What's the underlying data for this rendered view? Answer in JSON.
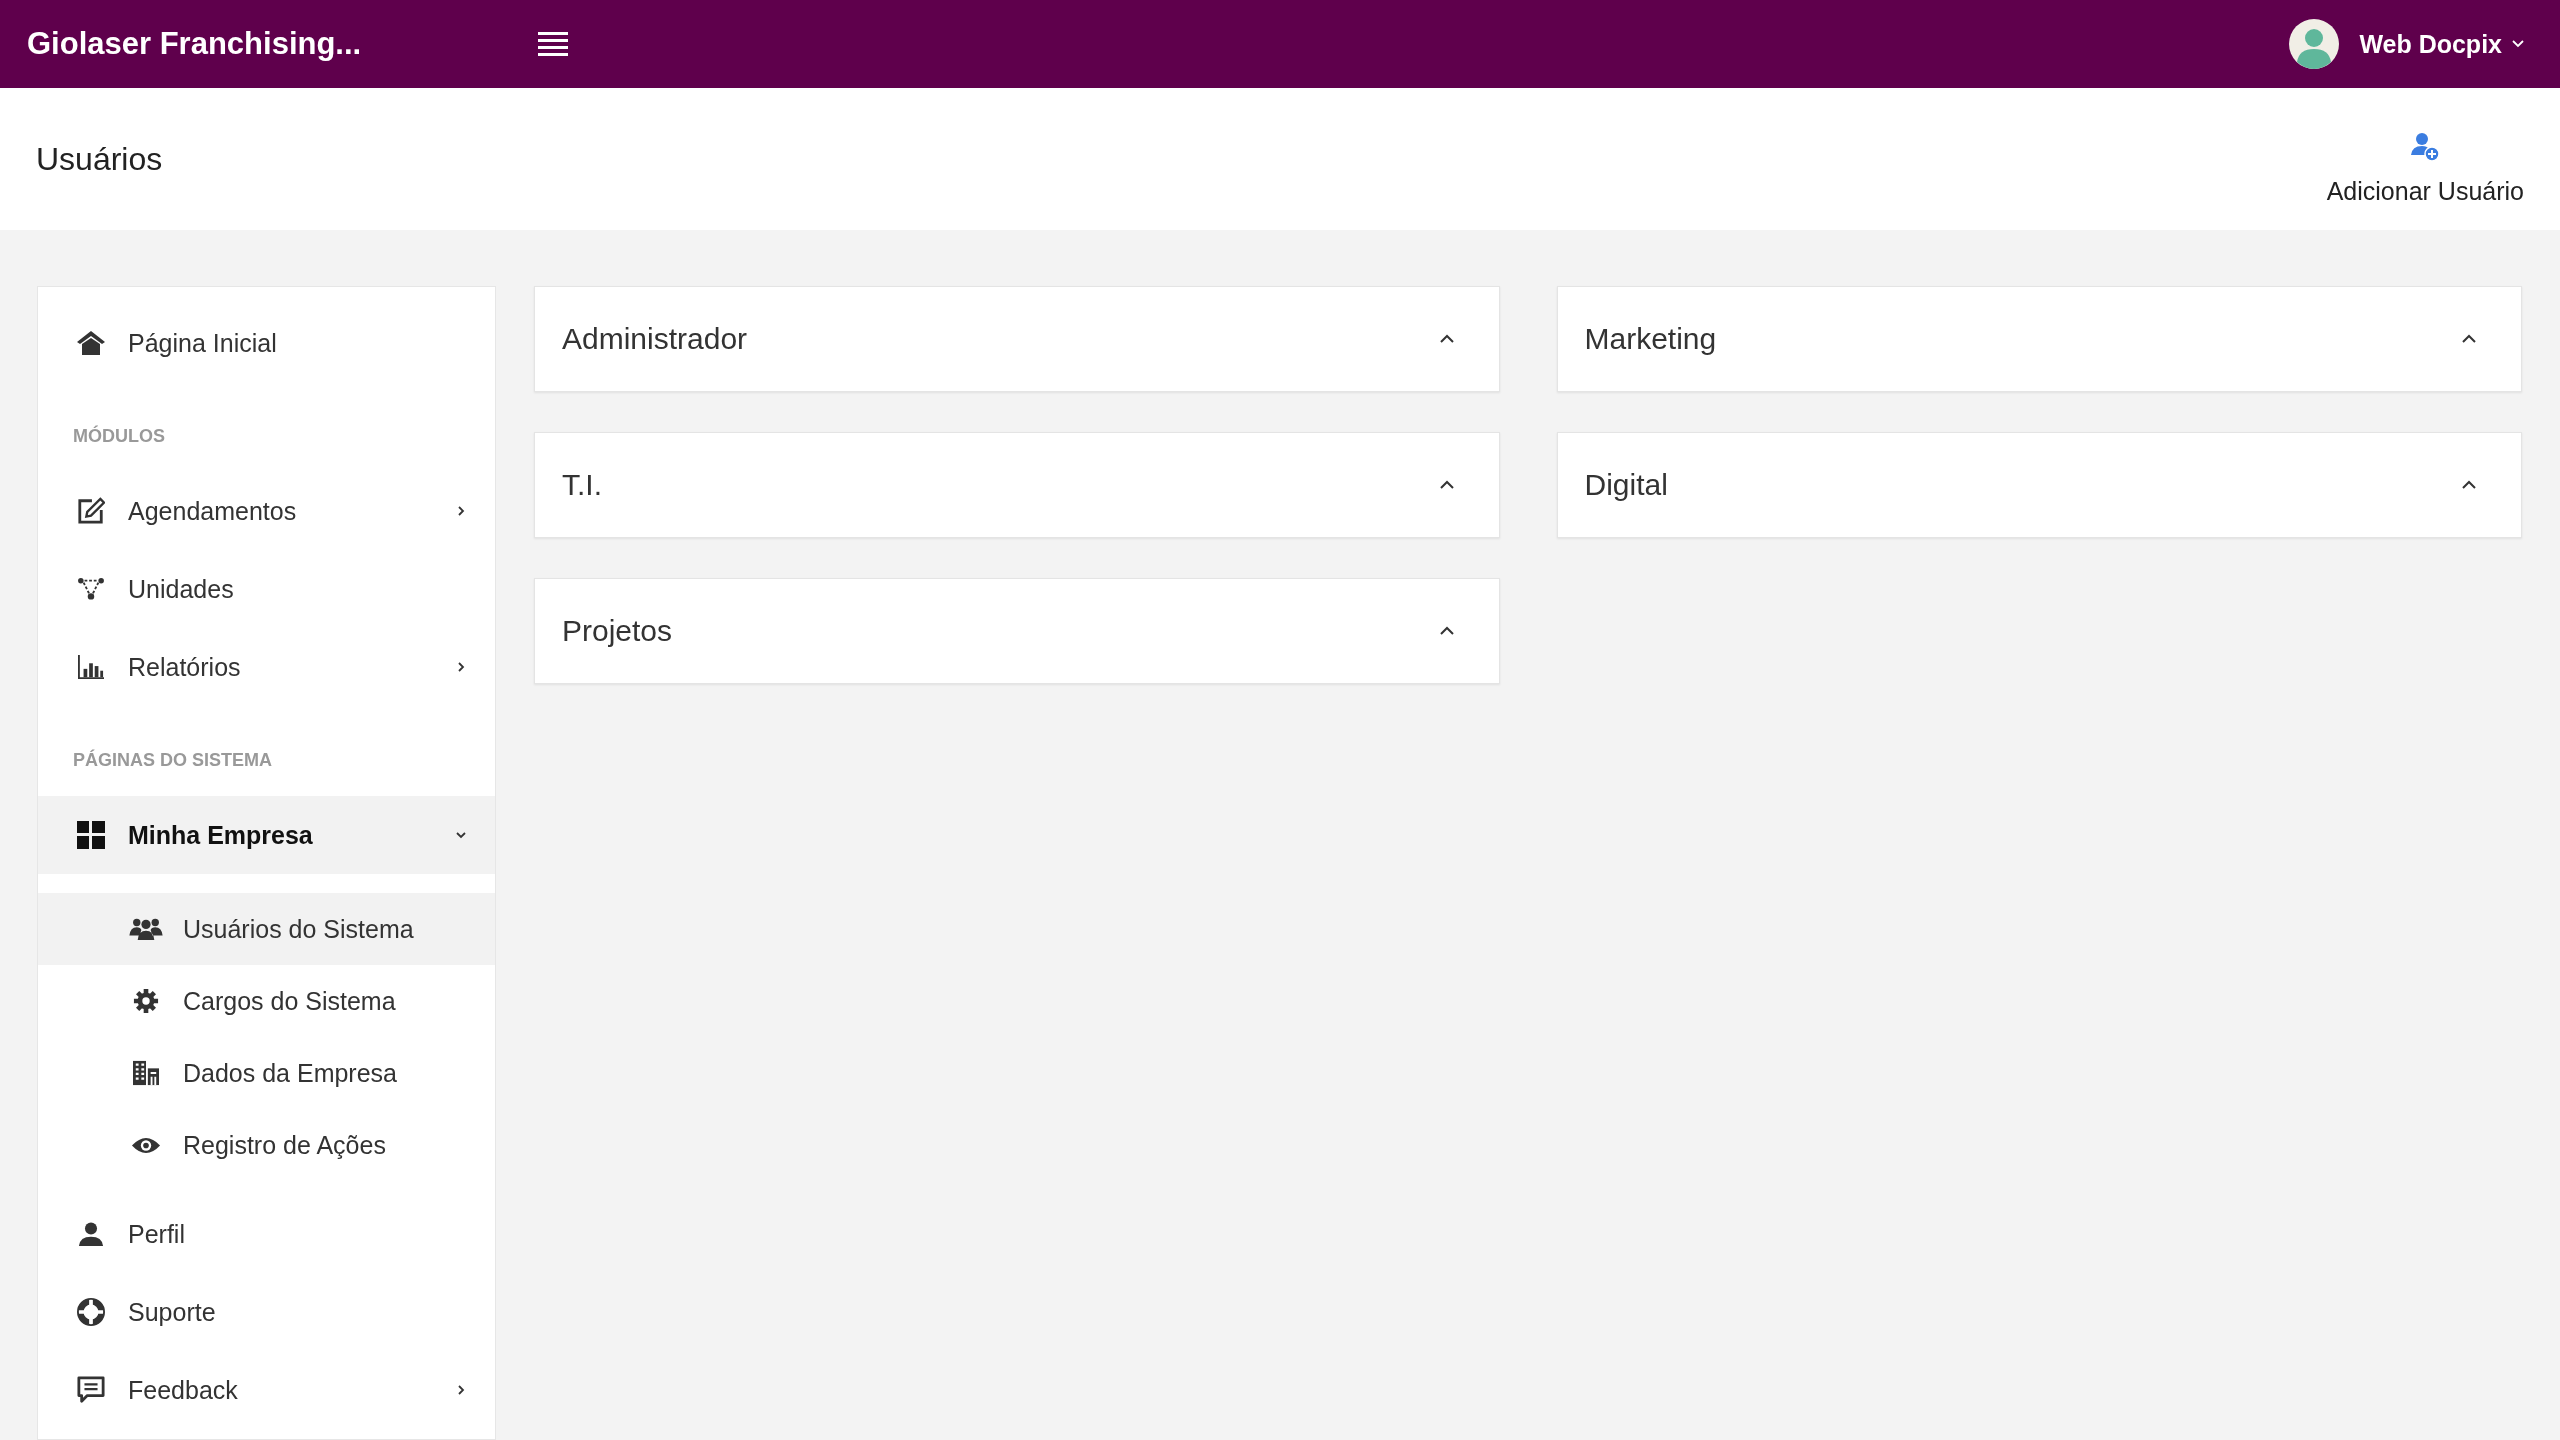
{
  "topbar": {
    "brand": "Giolaser Franchising...",
    "user": {
      "name": "Web Docpix"
    }
  },
  "page_header": {
    "title": "Usuários",
    "action": "Adicionar Usuário"
  },
  "sidebar": {
    "items": [
      {
        "kind": "link",
        "label": "Página Inicial",
        "selected": false
      },
      {
        "kind": "section",
        "label": "MÓDULOS"
      },
      {
        "kind": "menu",
        "label": "Agendamentos",
        "selected": false,
        "expanded": false
      },
      {
        "kind": "link",
        "label": "Unidades",
        "selected": false
      },
      {
        "kind": "menu",
        "label": "Relatórios",
        "selected": false,
        "expanded": false
      },
      {
        "kind": "section",
        "label": "PÁGINAS DO SISTEMA"
      },
      {
        "kind": "menu",
        "label": "Minha Empresa",
        "selected": true,
        "expanded": true,
        "children": [
          {
            "label": "Usuários do Sistema",
            "selected": true
          },
          {
            "label": "Cargos do Sistema",
            "selected": false
          },
          {
            "label": "Dados da Empresa",
            "selected": false
          },
          {
            "label": "Registro de Ações",
            "selected": false
          }
        ]
      },
      {
        "kind": "link",
        "label": "Perfil",
        "selected": false
      },
      {
        "kind": "link",
        "label": "Suporte",
        "selected": false
      },
      {
        "kind": "menu",
        "label": "Feedback",
        "selected": false,
        "expanded": false
      }
    ]
  },
  "panels": {
    "columns": [
      [
        {
          "title": "Administrador",
          "expanded": true
        },
        {
          "title": "T.I.",
          "expanded": true
        },
        {
          "title": "Projetos",
          "expanded": true
        }
      ],
      [
        {
          "title": "Marketing",
          "expanded": true
        },
        {
          "title": "Digital",
          "expanded": true
        }
      ]
    ]
  }
}
